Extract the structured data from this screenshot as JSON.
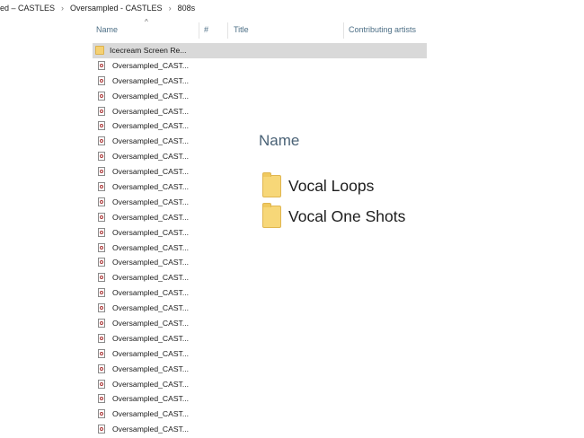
{
  "breadcrumb": [
    "ed – CASTLES",
    "Oversampled - CASTLES",
    "808s"
  ],
  "breadcrumb_separator": "›",
  "columns": {
    "name": "Name",
    "number": "#",
    "title": "Title",
    "artists": "Contributing artists"
  },
  "sort_indicator": "^",
  "files": [
    {
      "label": "Icecream Screen Re...",
      "type": "folder",
      "selected": true
    },
    {
      "label": "Oversampled_CAST...",
      "type": "audio"
    },
    {
      "label": "Oversampled_CAST...",
      "type": "audio"
    },
    {
      "label": "Oversampled_CAST...",
      "type": "audio"
    },
    {
      "label": "Oversampled_CAST...",
      "type": "audio"
    },
    {
      "label": "Oversampled_CAST...",
      "type": "audio"
    },
    {
      "label": "Oversampled_CAST...",
      "type": "audio"
    },
    {
      "label": "Oversampled_CAST...",
      "type": "audio"
    },
    {
      "label": "Oversampled_CAST...",
      "type": "audio"
    },
    {
      "label": "Oversampled_CAST...",
      "type": "audio"
    },
    {
      "label": "Oversampled_CAST...",
      "type": "audio"
    },
    {
      "label": "Oversampled_CAST...",
      "type": "audio"
    },
    {
      "label": "Oversampled_CAST...",
      "type": "audio"
    },
    {
      "label": "Oversampled_CAST...",
      "type": "audio"
    },
    {
      "label": "Oversampled_CAST...",
      "type": "audio"
    },
    {
      "label": "Oversampled_CAST...",
      "type": "audio"
    },
    {
      "label": "Oversampled_CAST...",
      "type": "audio"
    },
    {
      "label": "Oversampled_CAST...",
      "type": "audio"
    },
    {
      "label": "Oversampled_CAST...",
      "type": "audio"
    },
    {
      "label": "Oversampled_CAST...",
      "type": "audio"
    },
    {
      "label": "Oversampled_CAST...",
      "type": "audio"
    },
    {
      "label": "Oversampled_CAST...",
      "type": "audio"
    },
    {
      "label": "Oversampled_CAST...",
      "type": "audio"
    },
    {
      "label": "Oversampled_CAST...",
      "type": "audio"
    },
    {
      "label": "Oversampled_CAST...",
      "type": "audio"
    },
    {
      "label": "Oversampled_CAST...",
      "type": "audio"
    }
  ],
  "overlay": {
    "heading": "Name",
    "folders": [
      "Vocal Loops",
      "Vocal One Shots"
    ]
  },
  "colors": {
    "selection": "#d9d9d9",
    "folder": "#f7d778",
    "header_text": "#4d6f86"
  }
}
